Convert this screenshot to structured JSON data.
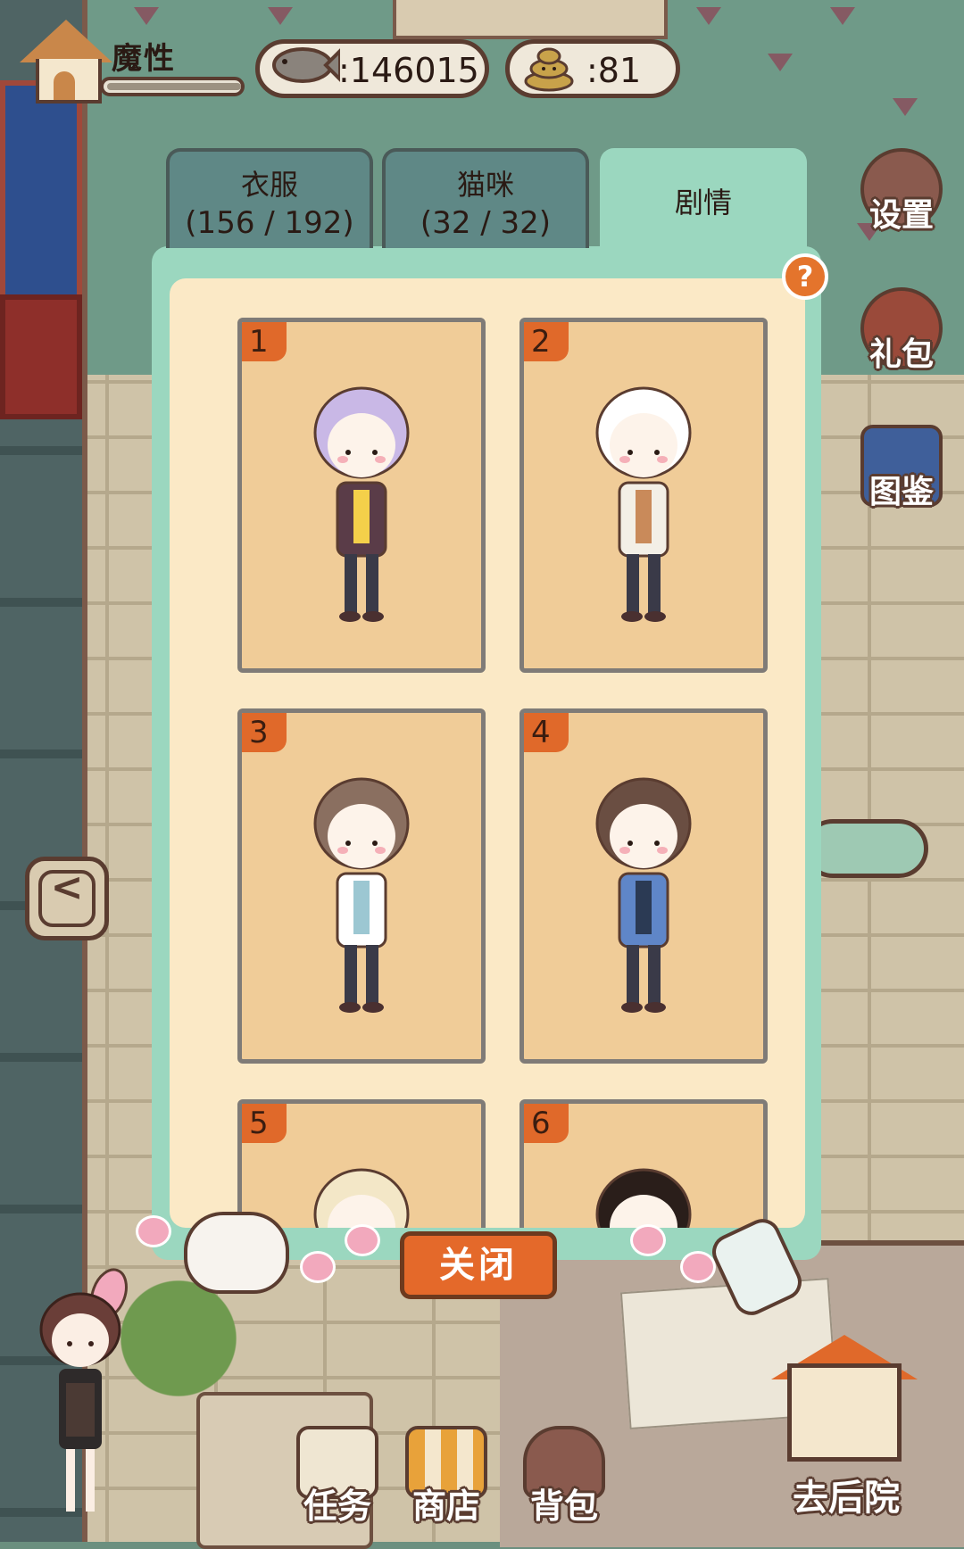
{
  "hud": {
    "player_name": "魔性",
    "fish_count": ":146015",
    "poop_count": ":81"
  },
  "tabs": [
    {
      "line1": "衣服",
      "line2": "(156 / 192)",
      "active": false
    },
    {
      "line1": "猫咪",
      "line2": "(32 / 32)",
      "active": false
    },
    {
      "line1": "剧情",
      "line2": "",
      "active": true
    }
  ],
  "help_label": "?",
  "cards": [
    {
      "number": "1",
      "hair": "#c9b8e6",
      "outfit": "#5a3c48",
      "accent": "#f4d04a"
    },
    {
      "number": "2",
      "hair": "#ffffff",
      "outfit": "#f3efe6",
      "accent": "#c98a5a"
    },
    {
      "number": "3",
      "hair": "#8a6f60",
      "outfit": "#ffffff",
      "accent": "#9cc7d2"
    },
    {
      "number": "4",
      "hair": "#6a4e42",
      "outfit": "#5f86c8",
      "accent": "#2b3a54"
    },
    {
      "number": "5",
      "hair": "#f3e7c7",
      "outfit": "#ffffff",
      "accent": "#ffffff"
    },
    {
      "number": "6",
      "hair": "#2a1e1a",
      "outfit": "#ffffff",
      "accent": "#ffffff"
    }
  ],
  "close_label": "关闭",
  "side_buttons": {
    "settings": "设置",
    "gift": "礼包",
    "catalog": "图鉴"
  },
  "back_label": "<",
  "bottom_nav": {
    "tasks": "任务",
    "shop": "商店",
    "bag": "背包",
    "backyard": "去后院"
  },
  "colors": {
    "panel_mint": "#9bd7bf",
    "card_bg": "#f0cc98",
    "badge_orange": "#e0692a",
    "outline_brown": "#5a3c30"
  }
}
